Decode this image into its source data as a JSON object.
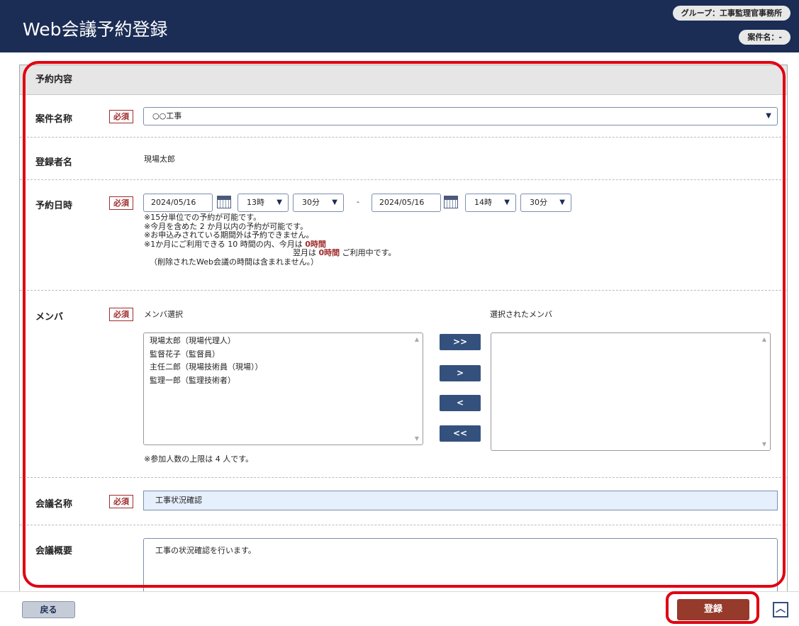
{
  "header": {
    "title": "Web会議予約登録",
    "group_pill": "グループ：工事監理官事務所",
    "case_pill": "案件名：-"
  },
  "section": {
    "title": "予約内容"
  },
  "required_badge": "必須",
  "case_name": {
    "label": "案件名称",
    "value": "○○工事"
  },
  "registrant": {
    "label": "登録者名",
    "value": "現場太郎"
  },
  "reservation": {
    "label": "予約日時",
    "start_date": "2024/05/16",
    "start_hour": "13時",
    "start_min": "30分",
    "separator": "-",
    "end_date": "2024/05/16",
    "end_hour": "14時",
    "end_min": "30分",
    "notes": [
      "※15分単位での予約が可能です。",
      "※今月を含めた 2 か月以内の予約が可能です。",
      "※お申込みされている期間外は予約できません。"
    ],
    "usage_prefix": "※1か月にご利用できる 10 時間の内、今月は ",
    "usage_this_month": "0時間",
    "usage_next_prefix": "翌月は ",
    "usage_next_month": "0時間",
    "usage_next_suffix": " ご利用中です。",
    "usage_excluded": "（削除されたWeb会議の時間は含まれません。）"
  },
  "members": {
    "label": "メンバ",
    "select_label": "メンバ選択",
    "selected_label": "選択されたメンバ",
    "available": [
      "現場太郎（現場代理人）",
      "監督花子（監督員）",
      "主任二郎（現場技術員（現場））",
      "監理一郎（監理技術者）"
    ],
    "buttons": {
      "add_all": ">>",
      "add": ">",
      "remove": "<",
      "remove_all": "<<"
    },
    "limit_note": "※参加人数の上限は 4 人です。"
  },
  "meeting_name": {
    "label": "会議名称",
    "value": "工事状況確認"
  },
  "meeting_summary": {
    "label": "会議概要",
    "value": "工事の状況確認を行います。"
  },
  "footer": {
    "back": "戻る",
    "submit": "登録",
    "top_icon": "chevron-up-icon"
  },
  "colors": {
    "header": "#1b2d55",
    "required": "#a02c2c",
    "submit": "#963a2c",
    "highlight": "#e00012"
  }
}
